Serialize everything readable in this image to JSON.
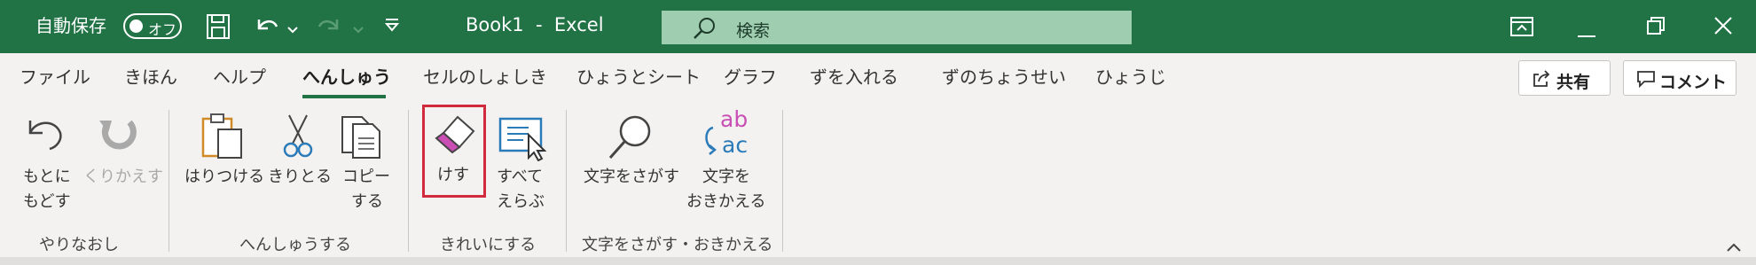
{
  "titlebar": {
    "autosave_label": "自動保存",
    "autosave_state": "オフ",
    "document_title": "Book1  -  Excel",
    "search_placeholder": "検索",
    "background": "#217346"
  },
  "tabs": [
    {
      "label": "ファイル"
    },
    {
      "label": "きほん"
    },
    {
      "label": "ヘルプ"
    },
    {
      "label": "へんしゅう",
      "active": true
    },
    {
      "label": "セルのしょしき"
    },
    {
      "label": "ひょうとシート"
    },
    {
      "label": "グラフ"
    },
    {
      "label": "ずを入れる"
    },
    {
      "label": "ずのちょうせい"
    },
    {
      "label": "ひょうじ"
    }
  ],
  "right_buttons": {
    "share": "共有",
    "comment": "コメント"
  },
  "ribbon": {
    "undo": {
      "line1": "もとに",
      "line2": "もどす"
    },
    "redo": {
      "line1": "くりかえす"
    },
    "paste": {
      "line1": "はりつける"
    },
    "cut": {
      "line1": "きりとる"
    },
    "copy": {
      "line1": "コピー",
      "line2": "する"
    },
    "clear": {
      "line1": "けす"
    },
    "select_all": {
      "line1": "すべて",
      "line2": "えらぶ"
    },
    "find": {
      "line1": "文字をさがす"
    },
    "replace": {
      "line1": "文字を",
      "line2": "おきかえる",
      "icon_text_top": "ab",
      "icon_text_bottom": "ac"
    },
    "groups": {
      "undo_redo": "やりなおし",
      "edit": "へんしゅうする",
      "clean": "きれいにする",
      "find_replace": "文字をさがす・おきかえる"
    }
  },
  "colors": {
    "accent": "#217346",
    "highlight": "#d22a3d",
    "eraser": "#c94fb4",
    "blue_icon": "#2b7bb9"
  }
}
